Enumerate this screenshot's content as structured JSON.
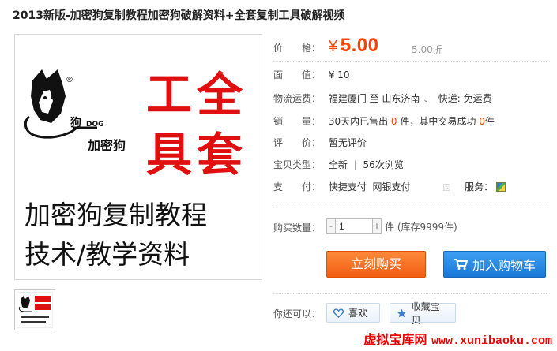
{
  "title": "2013新版-加密狗复制教程加密狗破解资料+全套复制工具破解视频",
  "image": {
    "big_text_1": "工全",
    "big_text_2": "具套",
    "dog_label_cn": "狗",
    "dog_label_en": "DOG",
    "brand": "加密狗",
    "caption_line1": "加密狗复制教程",
    "caption_line2": "技术/教学资料",
    "registered": "®"
  },
  "price": {
    "label": "价　　格：",
    "symbol": "¥",
    "value": "5.00",
    "discount": "5.00折"
  },
  "face_value": {
    "label": "面　　值：",
    "value": "¥ 10"
  },
  "shipping": {
    "label": "物流运费：",
    "from": "福建厦门",
    "sep": "至",
    "to": "山东济南",
    "caret": "⌄",
    "method": "快递: 免运费"
  },
  "sales": {
    "label": "销　　量：",
    "prefix": "30天内已售出 ",
    "sold": "0",
    "mid": " 件，其中交易成功 ",
    "success": "0",
    "suffix": "件"
  },
  "review": {
    "label": "评　　价：",
    "value": "暂无评价"
  },
  "type": {
    "label": "宝贝类型：",
    "value": "全新",
    "sep": "|",
    "views": "56次浏览"
  },
  "payment": {
    "label": "支　　付：",
    "value": "快捷支付  网银支付",
    "caret": "⌄",
    "service_label": "服务："
  },
  "quantity": {
    "label": "购买数量：",
    "minus": "-",
    "value": "1",
    "plus": "+",
    "stock": "件 (库存9999件)"
  },
  "buttons": {
    "buy": "立刻购买",
    "cart": "加入购物车"
  },
  "extra": {
    "label": "你还可以：",
    "like": "喜欢",
    "favorite": "收藏宝贝"
  },
  "watermark": {
    "cn": "虚拟宝库网",
    "url": "www.xunibaoku.com"
  },
  "colors": {
    "price": "#ff4400",
    "buy_button": "#f15d13",
    "cart_button": "#1977d6",
    "big_text": "#e01010"
  }
}
